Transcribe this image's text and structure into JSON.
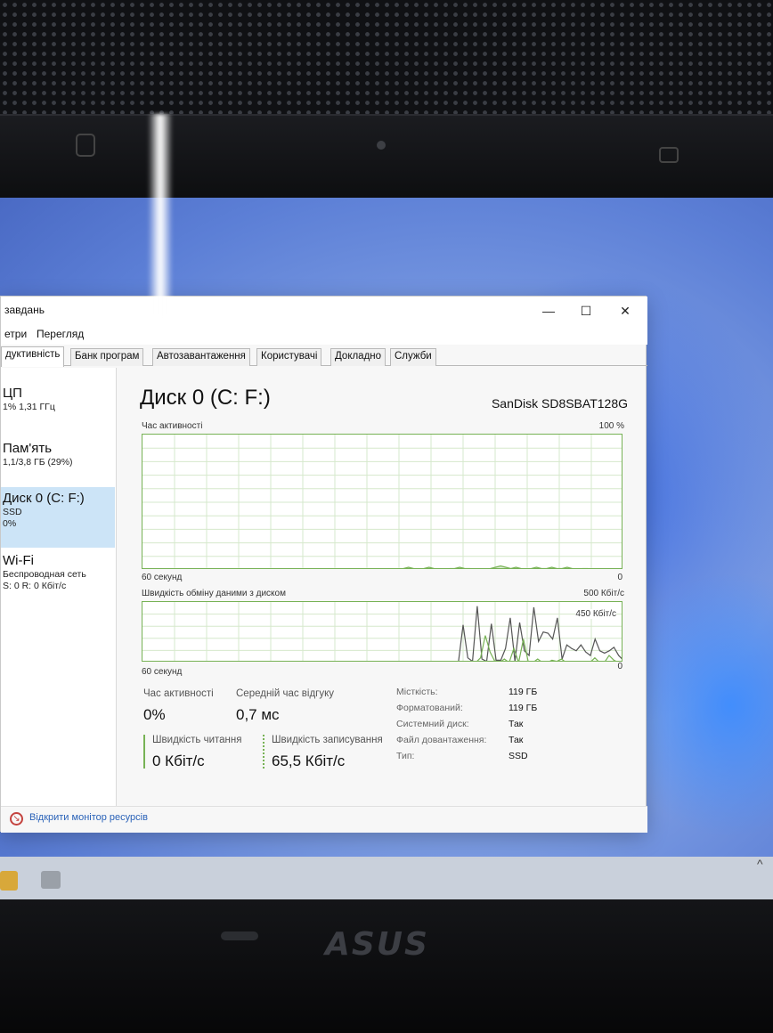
{
  "window": {
    "title": "завдань",
    "minimize_icon": "minimize-icon",
    "maximize_icon": "maximize-icon",
    "close_icon": "close-icon",
    "minimize_glyph": "—",
    "maximize_glyph": "☐",
    "close_glyph": "✕"
  },
  "menu": [
    "етри",
    "Перегляд"
  ],
  "tabs": [
    {
      "label": "дуктивність",
      "active": true
    },
    {
      "label": "Банк програм",
      "active": false
    },
    {
      "label": "Автозавантаження",
      "active": false
    },
    {
      "label": "Користувачі",
      "active": false
    },
    {
      "label": "Докладно",
      "active": false
    },
    {
      "label": "Служби",
      "active": false
    }
  ],
  "sidebar": [
    {
      "name": "ЦП",
      "sub1": "1% 1,31 ГГц",
      "sub2": "",
      "selected": false
    },
    {
      "name": "Пам'ять",
      "sub1": "1,1/3,8 ГБ (29%)",
      "sub2": "",
      "selected": false
    },
    {
      "name": "Диск 0 (C: F:)",
      "sub1": "SSD",
      "sub2": "0%",
      "selected": true
    },
    {
      "name": "Wi-Fi",
      "sub1": "Беспроводная сеть",
      "sub2": "S: 0 R: 0 Кбіт/с",
      "selected": false
    }
  ],
  "main": {
    "title": "Диск 0 (C: F:)",
    "model": "SanDisk SD8SBAT128G",
    "graph1": {
      "label": "Час активності",
      "max_label": "100 %",
      "time_label": "60 секунд",
      "zero_label": "0",
      "activity_values": [
        0,
        0,
        0,
        0,
        0,
        0,
        0,
        0,
        0,
        0,
        0,
        0,
        0,
        0,
        0,
        0,
        0,
        0,
        0,
        0,
        0,
        0,
        0,
        0,
        0,
        0,
        0,
        0,
        0,
        0,
        0,
        0,
        0,
        0,
        0,
        0,
        0,
        0,
        0,
        0,
        0,
        0,
        0,
        0,
        0,
        0,
        0,
        0,
        0,
        0,
        0,
        1,
        2,
        1,
        0,
        1,
        2,
        1,
        0,
        0,
        1,
        1,
        2,
        1,
        1,
        0,
        0,
        0,
        1,
        2,
        3,
        2,
        1,
        2,
        1,
        0,
        1,
        2,
        1,
        1,
        2,
        1,
        1,
        2,
        1,
        0,
        1,
        1,
        0,
        0,
        0,
        0,
        0,
        0,
        0
      ]
    },
    "graph2": {
      "label": "Швидкість обміну даними з диском",
      "max_label": "500 Кбіт/с",
      "inner_label": "450 Кбіт/с",
      "time_label": "60 секунд",
      "zero_label": "0",
      "max": 500,
      "write_values": [
        0,
        0,
        0,
        0,
        0,
        0,
        0,
        0,
        0,
        0,
        0,
        0,
        0,
        0,
        0,
        0,
        0,
        0,
        0,
        0,
        0,
        0,
        0,
        0,
        0,
        0,
        0,
        0,
        0,
        0,
        0,
        0,
        0,
        0,
        0,
        0,
        0,
        0,
        0,
        0,
        0,
        0,
        0,
        0,
        0,
        0,
        0,
        0,
        0,
        0,
        0,
        0,
        0,
        0,
        0,
        0,
        0,
        0,
        0,
        0,
        0,
        0,
        0,
        0,
        0,
        0,
        0,
        0,
        320,
        40,
        10,
        480,
        30,
        10,
        330,
        20,
        20,
        120,
        380,
        10,
        340,
        100,
        60,
        470,
        180,
        260,
        250,
        200,
        380,
        30,
        150,
        120,
        100,
        150,
        90,
        60,
        200,
        100,
        80,
        100,
        130,
        60,
        20
      ],
      "read_values": [
        0,
        0,
        0,
        0,
        0,
        0,
        0,
        0,
        0,
        0,
        0,
        0,
        0,
        0,
        0,
        0,
        0,
        0,
        0,
        0,
        0,
        0,
        0,
        0,
        0,
        0,
        0,
        0,
        0,
        0,
        0,
        0,
        0,
        0,
        0,
        0,
        0,
        0,
        0,
        0,
        0,
        0,
        0,
        0,
        0,
        0,
        0,
        0,
        0,
        0,
        0,
        0,
        0,
        0,
        0,
        0,
        0,
        0,
        0,
        0,
        0,
        0,
        0,
        0,
        0,
        0,
        0,
        0,
        0,
        10,
        0,
        40,
        230,
        90,
        10,
        0,
        30,
        0,
        120,
        0,
        200,
        10,
        0,
        30,
        0,
        0,
        20,
        10,
        30,
        0,
        0,
        0,
        10,
        0,
        0,
        40,
        0,
        0,
        60,
        20,
        0,
        0
      ]
    },
    "stats": {
      "active_label": "Час активності",
      "active_value": "0%",
      "response_label": "Середній час відгуку",
      "response_value": "0,7 мс",
      "read_label": "Швидкість читання",
      "read_value": "0 Кбіт/с",
      "write_label": "Швидкість записування",
      "write_value": "65,5 Кбіт/с"
    },
    "properties": [
      {
        "key": "Місткість:",
        "value": "119 ГБ"
      },
      {
        "key": "Форматований:",
        "value": "119 ГБ"
      },
      {
        "key": "Системний диск:",
        "value": "Так"
      },
      {
        "key": "Файл довантаження:",
        "value": "Так"
      },
      {
        "key": "Тип:",
        "value": "SSD"
      }
    ]
  },
  "footer": {
    "link": "Відкрити монітор ресурсів",
    "icon": "resource-monitor-icon"
  },
  "device": {
    "brand": "ASUS"
  },
  "colors": {
    "accent_green": "#77b255",
    "selected": "#cce4f7",
    "link": "#2a62b8"
  }
}
